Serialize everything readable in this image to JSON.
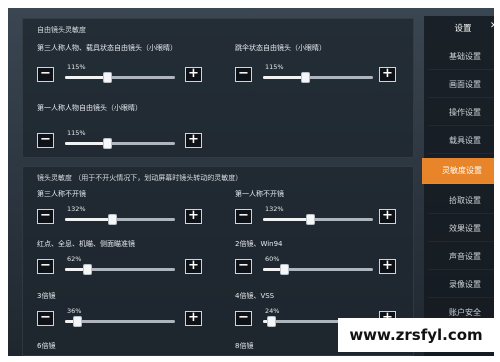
{
  "sidebar": {
    "title": "设置",
    "close": "✕",
    "items": [
      {
        "label": "基础设置",
        "active": false
      },
      {
        "label": "画面设置",
        "active": false
      },
      {
        "label": "操作设置",
        "active": false
      },
      {
        "label": "载具设置",
        "active": false
      },
      {
        "label": "灵敏度设置",
        "active": true
      },
      {
        "label": "拾取设置",
        "active": false
      },
      {
        "label": "效果设置",
        "active": false
      },
      {
        "label": "声音设置",
        "active": false
      },
      {
        "label": "录像设置",
        "active": false
      },
      {
        "label": "账户安全",
        "active": false
      }
    ]
  },
  "free_look": {
    "title": "自由镜头灵敏度",
    "sliders": [
      {
        "label": "第三人称人物、载具状态自由镜头（小眼睛）",
        "value": "115%",
        "level": 0.38
      },
      {
        "label": "跳伞状态自由镜头（小眼睛）",
        "value": "115%",
        "level": 0.38
      },
      {
        "label": "第一人称人物自由镜头（小眼睛）",
        "value": "115%",
        "level": 0.38
      }
    ]
  },
  "camera": {
    "title": "镜头灵敏度 （用于不开火情况下，划动屏幕时镜头转动的灵敏度）",
    "sliders": [
      {
        "label": "第三人称不开镜",
        "value": "132%",
        "level": 0.43
      },
      {
        "label": "第一人称不开镜",
        "value": "132%",
        "level": 0.43
      },
      {
        "label": "红点、全息、机瞄、侧面瞄准镜",
        "value": "62%",
        "level": 0.2
      },
      {
        "label": "2倍镜、Win94",
        "value": "60%",
        "level": 0.19
      },
      {
        "label": "3倍镜",
        "value": "36%",
        "level": 0.11
      },
      {
        "label": "4倍镜、VSS",
        "value": "24%",
        "level": 0.07
      },
      {
        "label": "6倍镜",
        "value": "",
        "level": 0
      },
      {
        "label": "8倍镜",
        "value": "",
        "level": 0
      }
    ]
  },
  "controls": {
    "minus": "−",
    "plus": "+"
  },
  "watermark": "www.zrsfyl.com"
}
